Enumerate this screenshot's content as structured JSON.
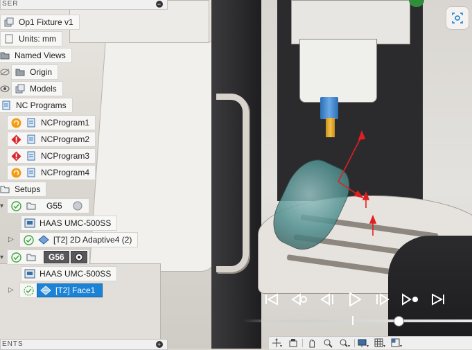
{
  "browser": {
    "header_label": "SER",
    "footer_label": "ENTS",
    "items": [
      {
        "label": "Op1 Fixture v1",
        "icon": "component-icon"
      },
      {
        "label": "Units: mm",
        "icon": "document-icon"
      },
      {
        "label": "Named Views",
        "icon": "folder-icon"
      },
      {
        "label": "Origin",
        "icon": "folder-icon"
      },
      {
        "label": "Models",
        "icon": "component-icon"
      },
      {
        "label": "NC Programs",
        "icon": "nc-icon"
      },
      {
        "label": "NCProgram1",
        "status": "warning"
      },
      {
        "label": "NCProgram2",
        "status": "error"
      },
      {
        "label": "NCProgram3",
        "status": "error"
      },
      {
        "label": "NCProgram4",
        "status": "warning"
      },
      {
        "label": "Setups",
        "icon": "folder-icon"
      },
      {
        "label": "G55"
      },
      {
        "label": "HAAS UMC-500SS"
      },
      {
        "label": "[T2] 2D Adaptive4 (2)"
      },
      {
        "label": "G56"
      },
      {
        "label": "HAAS UMC-500SS"
      },
      {
        "label": "[T2] Face1"
      }
    ]
  },
  "colors": {
    "accent": "#1b83d6",
    "warning": "#f39c12",
    "error": "#d9262c",
    "ok": "#3aa53a",
    "toolpath": "#e02020"
  },
  "playback": {
    "buttons": [
      "skip-start-icon",
      "prev-op-icon",
      "step-back-icon",
      "play-icon",
      "step-forward-icon",
      "next-op-icon",
      "skip-end-icon"
    ]
  },
  "navbar": {
    "buttons": [
      "orbit-icon",
      "look-at-icon",
      "pan-icon",
      "zoom-window-icon",
      "zoom-icon",
      "display-icon",
      "grid-icon",
      "viewports-icon"
    ]
  }
}
